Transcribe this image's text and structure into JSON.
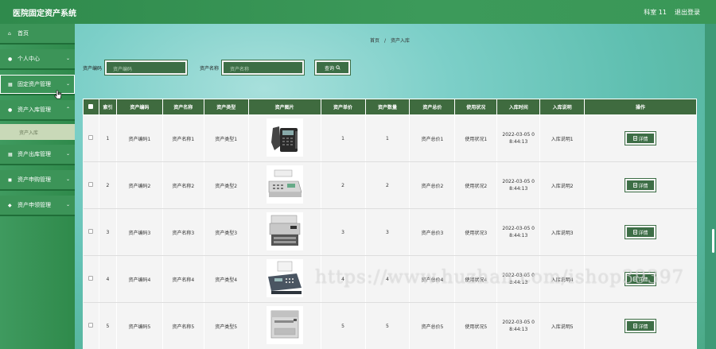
{
  "app": {
    "title": "医院固定资产系统"
  },
  "topbar": {
    "user": "科室 11",
    "logout": "退出登录"
  },
  "sidebar": {
    "items": [
      {
        "label": "首页",
        "icon": "home-icon",
        "glyph": "⌂",
        "chevron": ""
      },
      {
        "label": "个人中心",
        "icon": "user-icon",
        "glyph": "●",
        "chevron": "⌄"
      },
      {
        "label": "固定资产管理",
        "icon": "grid-icon",
        "glyph": "▦",
        "chevron": "⌄"
      },
      {
        "label": "资产入库管理",
        "icon": "user-icon",
        "glyph": "●",
        "chevron": "⌃"
      },
      {
        "label": "资产出库管理",
        "icon": "apps-icon",
        "glyph": "▦",
        "chevron": "⌄"
      },
      {
        "label": "资产申购管理",
        "icon": "cart-icon",
        "glyph": "◼",
        "chevron": "⌄"
      },
      {
        "label": "资产申领管理",
        "icon": "pin-icon",
        "glyph": "◆",
        "chevron": "⌄"
      }
    ],
    "sub_item": "资产入库"
  },
  "breadcrumb": {
    "home": "首页",
    "sep": "/",
    "current": "资产入库"
  },
  "search": {
    "code_label": "资产编码",
    "code_placeholder": "资产编码",
    "name_label": "资产名称",
    "name_placeholder": "资产名称",
    "query_label": "查询",
    "query_icon": "search-icon"
  },
  "table": {
    "headers": [
      "索引",
      "资产编码",
      "资产名称",
      "资产类型",
      "资产图片",
      "资产单价",
      "资产数量",
      "资产总价",
      "使用状况",
      "入库时间",
      "入库说明",
      "操作"
    ],
    "rows": [
      {
        "index": "1",
        "code": "资产编码1",
        "name": "资产名称1",
        "type": "资产类型1",
        "price": "1",
        "qty": "1",
        "total": "资产总价1",
        "status": "使用状况1",
        "time": "2022-03-05 0\n8:44:13",
        "note": "入库说明1",
        "action": "详情",
        "image": "phone"
      },
      {
        "index": "2",
        "code": "资产编码2",
        "name": "资产名称2",
        "type": "资产类型2",
        "price": "2",
        "qty": "2",
        "total": "资产总价2",
        "status": "使用状况2",
        "time": "2022-03-05 0\n8:44:13",
        "note": "入库说明2",
        "action": "详情",
        "image": "fax"
      },
      {
        "index": "3",
        "code": "资产编码3",
        "name": "资产名称3",
        "type": "资产类型3",
        "price": "3",
        "qty": "3",
        "total": "资产总价3",
        "status": "使用状况3",
        "time": "2022-03-05 0\n8:44:13",
        "note": "入库说明3",
        "action": "详情",
        "image": "mfp"
      },
      {
        "index": "4",
        "code": "资产编码4",
        "name": "资产名称4",
        "type": "资产类型4",
        "price": "4",
        "qty": "4",
        "total": "资产总价4",
        "status": "使用状况4",
        "time": "2022-03-05 0\n8:44:13",
        "note": "入库说明4",
        "action": "详情",
        "image": "fax2"
      },
      {
        "index": "5",
        "code": "资产编码5",
        "name": "资产名称5",
        "type": "资产类型5",
        "price": "5",
        "qty": "5",
        "total": "资产总价5",
        "status": "使用状况5",
        "time": "2022-03-05 0\n8:44:13",
        "note": "入库说明5",
        "action": "详情",
        "image": "printer"
      }
    ]
  },
  "watermark": "https://www.huzhan.com/ishop39397",
  "colors": {
    "header_bg": "#2f8a4c",
    "table_header": "#3f6b3f",
    "button": "#3d6e46",
    "main_bg": "#7ccfc8"
  }
}
